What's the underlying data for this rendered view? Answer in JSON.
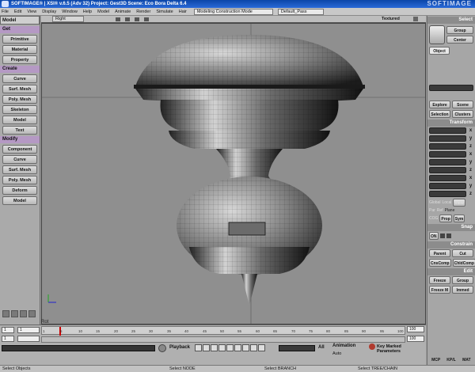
{
  "window": {
    "title": "SOFTIMAGE® | XSI® v.6.5 (Adv 32) Project: Gest3D     Scene: Eco Bora Delta 6.4",
    "watermark": "SOFTIMAGE"
  },
  "menu": [
    "File",
    "Edit",
    "View",
    "Display",
    "Window",
    "Help",
    "Model",
    "Animate",
    "Render",
    "Simulate",
    "Hair"
  ],
  "layout_dropdown": "Modeling Construction Mode",
  "pass_dropdown": "Default_Pass",
  "left_panel": {
    "module": "Model",
    "sections": [
      {
        "title": "Get",
        "items": [
          "Primitive",
          "Material",
          "Property"
        ]
      },
      {
        "title": "Create",
        "items": [
          "Curve",
          "Surf. Mesh",
          "Poly. Mesh",
          "Skeleton",
          "Model",
          "Text"
        ]
      },
      {
        "title": "Modify",
        "items": [
          "Component",
          "Curve",
          "Surf. Mesh",
          "Poly. Mesh",
          "Deform",
          "Model"
        ]
      }
    ]
  },
  "viewport": {
    "view": "Right",
    "shading": "Textured"
  },
  "right_panel": {
    "select_title": "Select",
    "group": "Group",
    "center": "Center",
    "object": "Object",
    "explore": "Explore",
    "scene": "Scene",
    "selection": "Selection",
    "clusters": "Clusters",
    "transform_title": "Transform",
    "axes": [
      "x",
      "y",
      "z"
    ],
    "ref": [
      "Global",
      "Local",
      "View"
    ],
    "ref2": [
      "Par",
      "Ref",
      "Plane"
    ],
    "cog": "COG",
    "prop": "Prop",
    "sym": "Sym",
    "snap_title": "Snap",
    "snap_on": "ON",
    "constrain_title": "Constrain",
    "parent": "Parent",
    "cut": "Cut",
    "cnscomp": "CnsComp",
    "chldcomp": "ChldComp",
    "edit_title": "Edit",
    "freeze": "Freeze",
    "group2": "Group",
    "freeze_m": "Freeze M",
    "immed": "Immed",
    "tabs": [
      "MCP",
      "KP/L",
      "MAT"
    ]
  },
  "timeline": {
    "start": "1",
    "end": "100",
    "ticks": [
      "1",
      "5",
      "10",
      "15",
      "20",
      "25",
      "30",
      "35",
      "40",
      "45",
      "50",
      "55",
      "60",
      "65",
      "70",
      "75",
      "80",
      "85",
      "90",
      "95",
      "100"
    ],
    "playback": "Playback",
    "all": "All",
    "animation": "Animation",
    "auto": "Auto",
    "key_params": "Key Marked Parameters",
    "start_field": "1",
    "end_field": "100",
    "rot_label": "Rot"
  },
  "status": [
    "Select Objects",
    "Select NODE",
    "Select BRANCH",
    "Select TREE/CHAIN"
  ],
  "colors": {
    "accent_header": "#b599c4",
    "viewport_bg": "#8f8f8f"
  }
}
